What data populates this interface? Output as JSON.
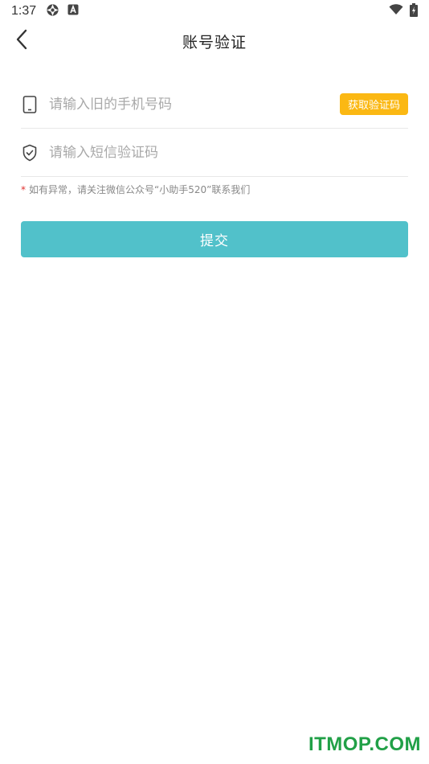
{
  "status_bar": {
    "time": "1:37",
    "icons": [
      "aperture-icon",
      "a-badge-icon",
      "wifi-icon",
      "battery-charging-icon"
    ]
  },
  "header": {
    "title": "账号验证",
    "back_icon": "chevron-left-icon"
  },
  "form": {
    "phone": {
      "icon": "phone-icon",
      "placeholder": "请输入旧的手机号码",
      "value": "",
      "code_button_label": "获取验证码"
    },
    "sms_code": {
      "icon": "shield-check-icon",
      "placeholder": "请输入短信验证码",
      "value": ""
    },
    "hint": {
      "star": "*",
      "text": "如有异常，请关注微信公众号“小助手520”联系我们"
    },
    "submit_label": "提交"
  },
  "watermark": "ITMOP.COM",
  "colors": {
    "accent_yellow": "#fbb813",
    "submit_teal": "#51c1ca",
    "hint_star_red": "#e0312f",
    "watermark_green": "#21a047"
  }
}
